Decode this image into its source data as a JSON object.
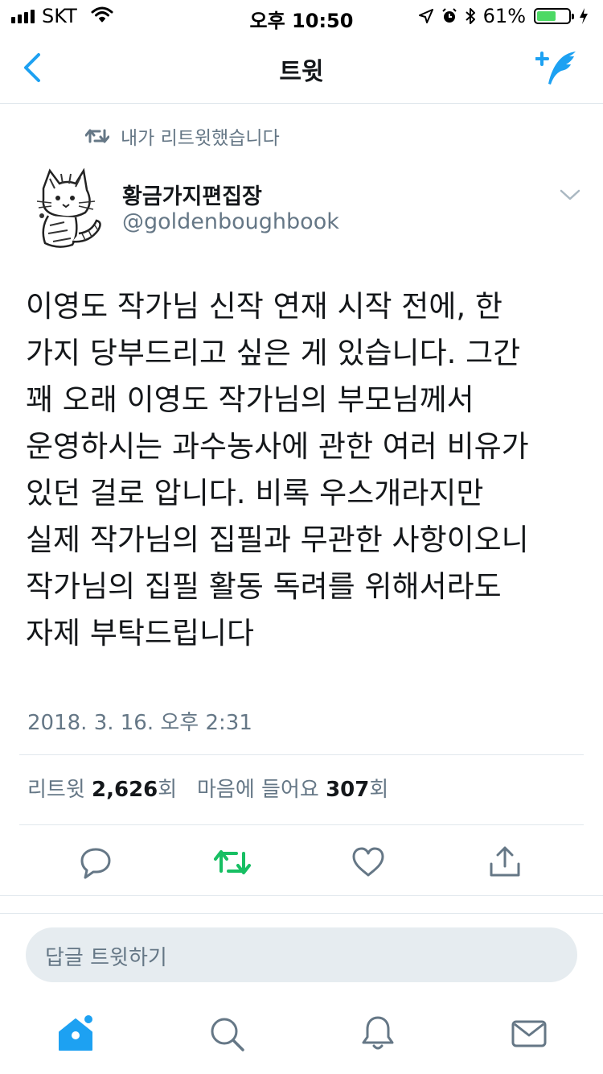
{
  "status_bar": {
    "carrier": "SKT",
    "time": "오후 10:50",
    "battery_percent": "61%",
    "battery_level": 0.61
  },
  "nav": {
    "title": "트윗"
  },
  "retweet_indicator": {
    "text": "내가 리트윗했습니다"
  },
  "author": {
    "display_name": "황금가지편집장",
    "handle": "@goldenboughbook"
  },
  "tweet": {
    "lines": [
      "이영도 작가님 신작 연재 시작 전에, 한",
      "가지 당부드리고 싶은 게 있습니다. 그간",
      "꽤 오래 이영도 작가님의 부모님께서",
      "운영하시는 과수농사에 관한 여러 비유가",
      "있던 걸로 압니다. 비록 우스개라지만",
      "실제 작가님의 집필과 무관한 사항이오니",
      "작가님의 집필 활동 독려를 위해서라도",
      "자제 부탁드립니다"
    ],
    "timestamp": "2018. 3. 16. 오후 2:31"
  },
  "stats": {
    "retweets_label": "리트윗",
    "retweets_count": "2,626",
    "retweets_unit": "회",
    "likes_label": "마음에 들어요",
    "likes_count": "307",
    "likes_unit": "회"
  },
  "reply": {
    "placeholder": "답글 트윗하기"
  },
  "colors": {
    "accent": "#1da1f2",
    "retweet_active": "#17bf63",
    "secondary_text": "#657786",
    "divider": "#e1e8ed"
  },
  "icons": [
    "back-arrow-icon",
    "compose-tweet-icon",
    "retweet-icon",
    "chevron-down-icon",
    "reply-icon",
    "like-heart-icon",
    "share-icon",
    "home-icon",
    "search-icon",
    "notifications-bell-icon",
    "messages-envelope-icon"
  ]
}
